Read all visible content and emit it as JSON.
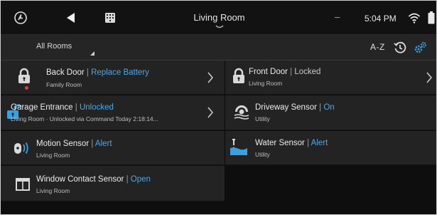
{
  "topbar": {
    "room_title": "Living Room",
    "dash": "–",
    "time": "5:04 PM",
    "icons": [
      "back-swirl-icon",
      "back-arrow-icon",
      "keypad-icon",
      "room-chevron-icon",
      "wifi-icon",
      "battery-icon"
    ]
  },
  "filterbar": {
    "filter_label": "All Rooms",
    "sort_label": "A-Z",
    "icons": [
      "history-icon",
      "settings-gear-icon"
    ]
  },
  "colors": {
    "accent": "#4aa8e8",
    "tile_bg": "#232323",
    "alert_dot": "#e53a2e"
  },
  "devices": [
    {
      "name": "Back Door",
      "status": "Replace Battery",
      "room": "Family Room",
      "icon": "lock-icon",
      "status_color": "accent",
      "chevron": true
    },
    {
      "name": "Front Door",
      "status": "Locked",
      "room": "Living Room",
      "icon": "lock-icon",
      "status_color": "gray",
      "chevron": true
    },
    {
      "name": "Garage Entrance",
      "status": "Unlocked",
      "room": "Living Room · Unlocked via Command Today 2:18:14...",
      "icon": "unlocked-lock-icon",
      "status_color": "accent",
      "chevron": true
    },
    {
      "name": "Driveway Sensor",
      "status": "On",
      "room": "Utility",
      "icon": "driveway-sensor-icon",
      "status_color": "accent",
      "chevron": false
    },
    {
      "name": "Motion Sensor",
      "status": "Alert",
      "room": "Living Room",
      "icon": "motion-sensor-icon",
      "status_color": "accent",
      "chevron": false
    },
    {
      "name": "Water Sensor",
      "status": "Alert",
      "room": "Utility",
      "icon": "water-sensor-icon",
      "status_color": "accent",
      "chevron": false
    },
    {
      "name": "Window Contact Sensor",
      "status": "Open",
      "room": "Living Room",
      "icon": "window-contact-icon",
      "status_color": "accent",
      "chevron": false
    }
  ]
}
